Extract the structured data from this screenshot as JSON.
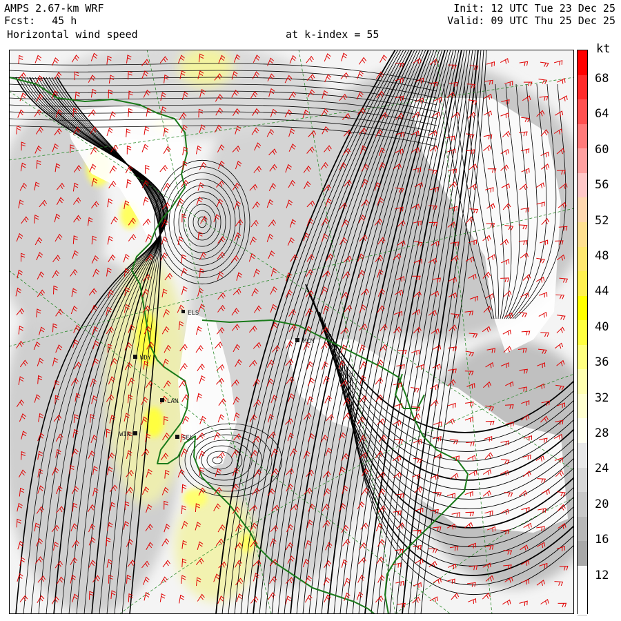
{
  "header": {
    "model": "AMPS 2.67-km WRF",
    "forecast_label": "Fcst:",
    "forecast_hours": "45 h",
    "field": "Horizontal wind speed",
    "level_label": "at k-index =",
    "level_value": "55",
    "init": "Init: 12 UTC Tue 23 Dec 25",
    "valid": "Valid: 09 UTC Thu 25 Dec 25"
  },
  "colorbar": {
    "unit": "kt",
    "ticks": [
      "68",
      "64",
      "60",
      "56",
      "52",
      "48",
      "44",
      "40",
      "36",
      "32",
      "28",
      "24",
      "20",
      "16",
      "12"
    ],
    "colors": [
      "#ff0000",
      "#ff2a2a",
      "#ff5050",
      "#ff7a7a",
      "#ffa0a0",
      "#ffc8c8",
      "#ffd8b0",
      "#ffe090",
      "#ffe870",
      "#fff050",
      "#ffff00",
      "#ffff40",
      "#ffff80",
      "#ffffb0",
      "#ffffd0",
      "#fffff0",
      "#e8e8e8",
      "#d8d8d8",
      "#c8c8c8",
      "#b8b8b8",
      "#a8a8a8",
      "#f8f8f8",
      "#ffffff"
    ]
  },
  "stations": [
    {
      "id": "ELS"
    },
    {
      "id": "WDY"
    },
    {
      "id": "LAN"
    },
    {
      "id": "WIN"
    },
    {
      "id": "SEL"
    },
    {
      "id": "MCM"
    }
  ],
  "colors": {
    "coastline": "#1a7a1a",
    "barbs": "#e00000",
    "streamlines": "#000000",
    "grid": "#2a8a2a"
  }
}
